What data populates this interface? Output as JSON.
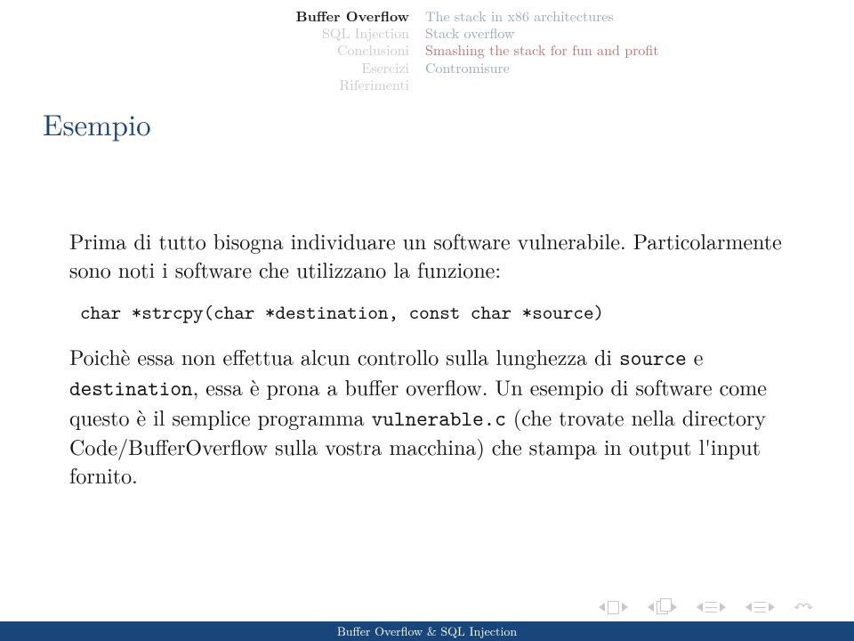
{
  "nav_left": {
    "l1": "Buffer Overflow",
    "l2": "SQL Injection",
    "l3": "Conclusioni",
    "l4": "Esercizi",
    "l5": "Riferimenti"
  },
  "nav_right": {
    "r1": "The stack in x86 architectures",
    "r2": "Stack overflow",
    "r3": "Smashing the stack for fun and profit",
    "r4": "Contromisure"
  },
  "title": "Esempio",
  "body": {
    "p1": "Prima di tutto bisogna individuare un software vulnerabile. Particolarmente sono noti i software che utilizzano la funzione:",
    "code": "char *strcpy(char *destination, const char *source)",
    "p2a": "Poichè essa non effettua alcun controllo sulla lunghezza di ",
    "tt_source": "source",
    "p2b": " e ",
    "tt_dest": "destination",
    "p2c": ", essa è prona a buffer overflow. Un esempio di software come questo è il semplice programma ",
    "tt_vuln": "vulnerable.c",
    "p2d": " (che trovate nella directory Code/BufferOverflow sulla vostra macchina) che stampa in output l'input fornito."
  },
  "footer": "Buffer Overflow & SQL Injection"
}
